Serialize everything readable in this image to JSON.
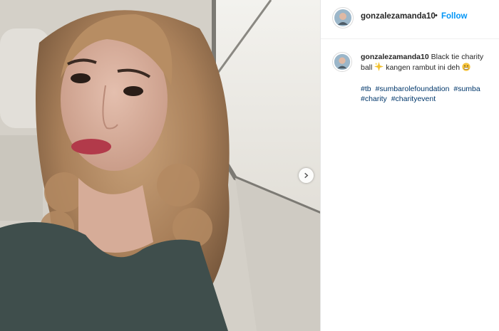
{
  "post": {
    "username": "gonzalezamanda10",
    "separator": "•",
    "follow_label": "Follow",
    "caption_user": "gonzalezamanda10",
    "caption_text_1": "Black tie charity ball",
    "caption_text_2": "kangen rambut ini deh",
    "hashtags": [
      "#tb",
      "#sumbarolefoundation",
      "#sumba",
      "#charity",
      "#charityevent"
    ]
  },
  "icons": {
    "carousel": "chevron-right-icon",
    "sparkle": "sparkles-emoji",
    "face": "grimace-emoji"
  },
  "colors": {
    "follow": "#0095f6",
    "hashtag": "#00376b",
    "text": "#262626"
  }
}
